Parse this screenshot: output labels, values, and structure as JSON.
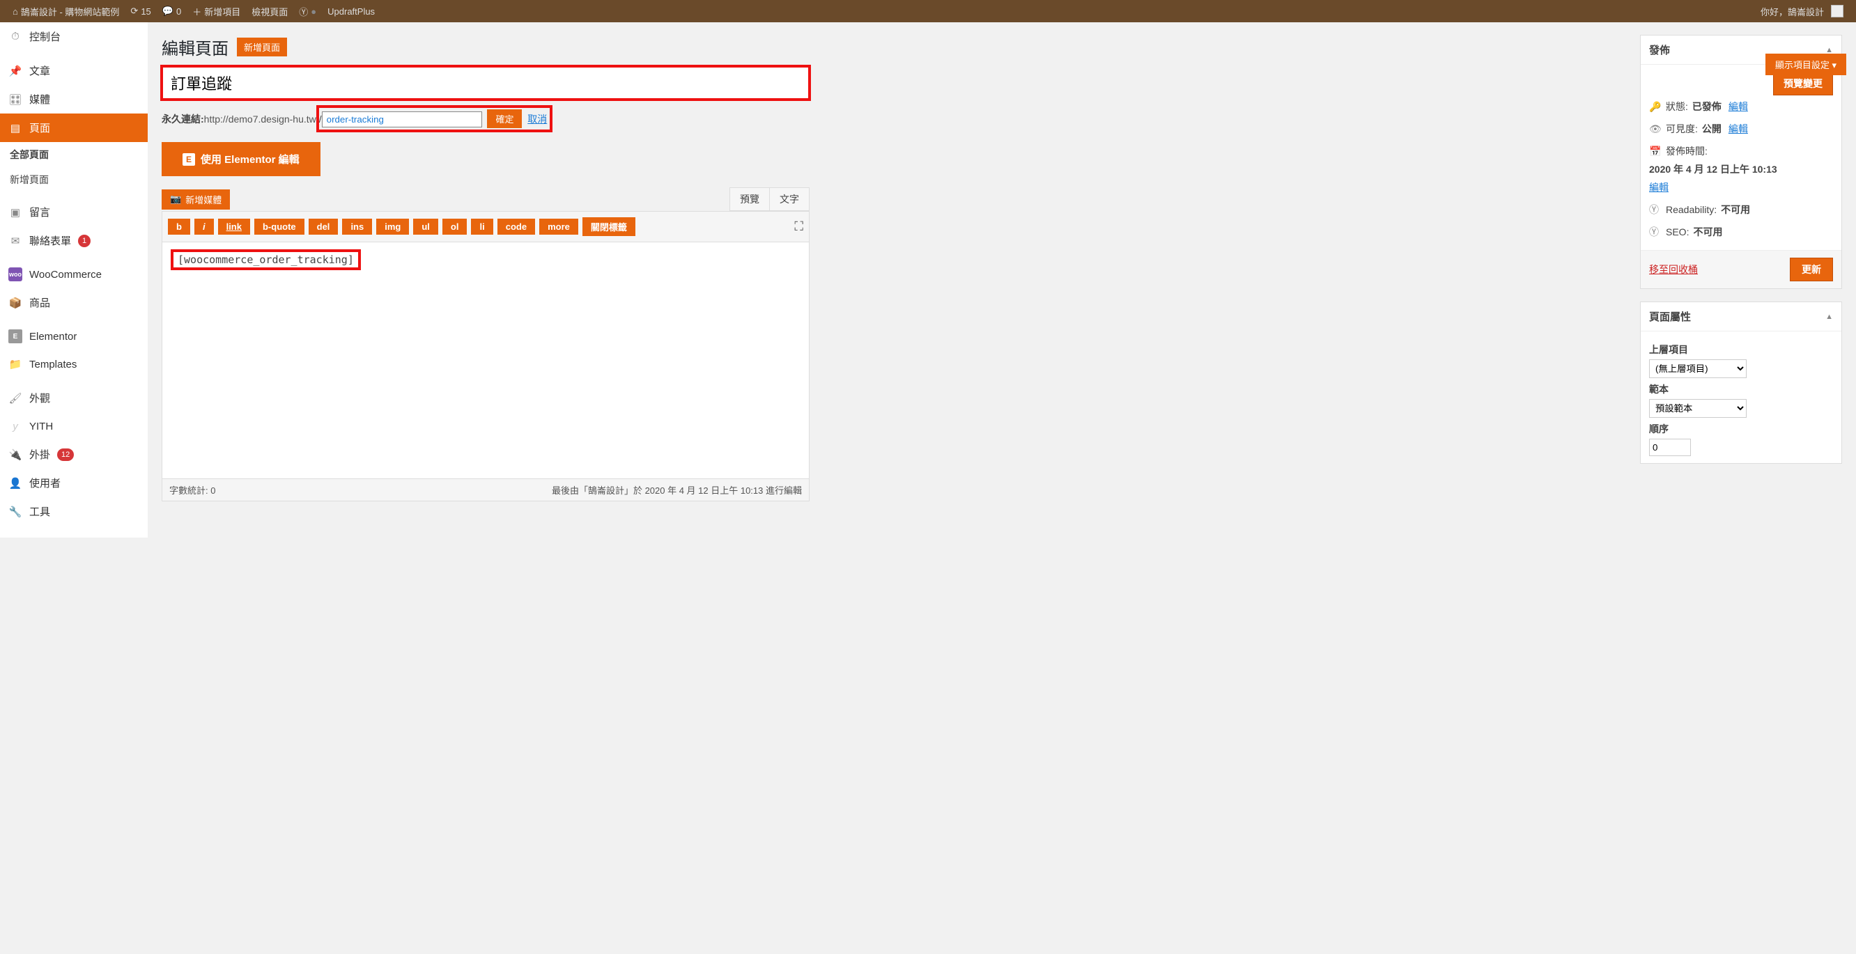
{
  "adminbar": {
    "site": "鵠崙設計 - 購物網站範例",
    "updates": "15",
    "comments": "0",
    "new": "新增項目",
    "viewpage": "檢視頁面",
    "updraft": "UpdraftPlus",
    "greeting": "你好，鵠崙設計"
  },
  "sidebar": {
    "dashboard": "控制台",
    "posts": "文章",
    "media": "媒體",
    "pages": "頁面",
    "pages_all": "全部頁面",
    "pages_new": "新增頁面",
    "comments": "留言",
    "contact": "聯絡表單",
    "contact_badge": "1",
    "woocommerce": "WooCommerce",
    "products": "商品",
    "elementor": "Elementor",
    "templates": "Templates",
    "appearance": "外觀",
    "yith": "YITH",
    "plugins": "外掛",
    "plugins_badge": "12",
    "users": "使用者",
    "tools": "工具"
  },
  "screen_options": "顯示項目設定",
  "heading": {
    "title": "編輯頁面",
    "add_new": "新增頁面"
  },
  "title_value": "訂單追蹤",
  "title_placeholder": "在此輸入標題",
  "permalink": {
    "label": "永久連結: ",
    "base": "http://demo7.design-hu.tw",
    "slash": "/",
    "slug": "order-tracking",
    "ok": "確定",
    "cancel": "取消"
  },
  "elementor_btn": "使用 Elementor 編輯",
  "media_btn": "新增媒體",
  "tabs": {
    "visual": "預覽",
    "text": "文字"
  },
  "qt": {
    "b": "b",
    "i": "i",
    "link": "link",
    "bquote": "b-quote",
    "del": "del",
    "ins": "ins",
    "img": "img",
    "ul": "ul",
    "ol": "ol",
    "li": "li",
    "code": "code",
    "more": "more",
    "close": "關閉標籤"
  },
  "content": "[woocommerce_order_tracking]",
  "wordcount_label": "字數統計: ",
  "wordcount": "0",
  "last_edit": "最後由「鵠崙設計」於 2020 年 4 月 12 日上午 10:13 進行編輯",
  "publish": {
    "title": "發佈",
    "preview": "預覽變更",
    "status_label": "狀態: ",
    "status": "已發佈",
    "edit": "編輯",
    "visibility_label": "可見度: ",
    "visibility": "公開",
    "published_label": "發佈時間: ",
    "published": "2020 年 4 月 12 日上午 10:13",
    "readability_label": "Readability: ",
    "readability": "不可用",
    "seo_label": "SEO: ",
    "seo": "不可用",
    "trash": "移至回收桶",
    "update": "更新"
  },
  "attributes": {
    "title": "頁面屬性",
    "parent_label": "上層項目",
    "parent_value": "(無上層項目)",
    "template_label": "範本",
    "template_value": "預設範本",
    "order_label": "順序",
    "order_value": "0"
  }
}
